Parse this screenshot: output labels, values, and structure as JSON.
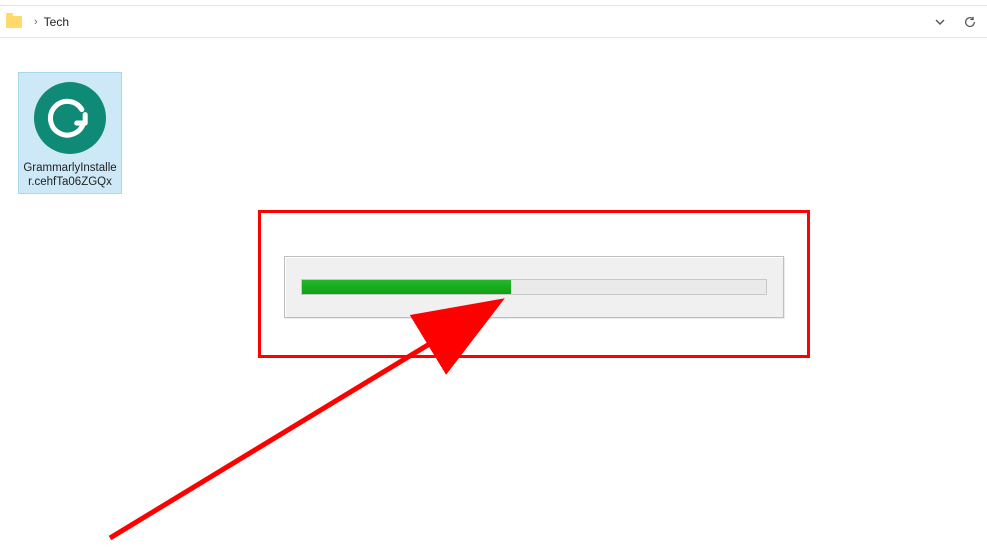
{
  "breadcrumb": {
    "current": "Tech"
  },
  "file": {
    "name": "GrammarlyInstaller.cehfTa06ZGQx",
    "icon": "grammarly-logo-icon",
    "icon_color": "#0f8a77"
  },
  "progress": {
    "percent": 45
  },
  "annotation": {
    "highlight_color": "#ff0000"
  }
}
